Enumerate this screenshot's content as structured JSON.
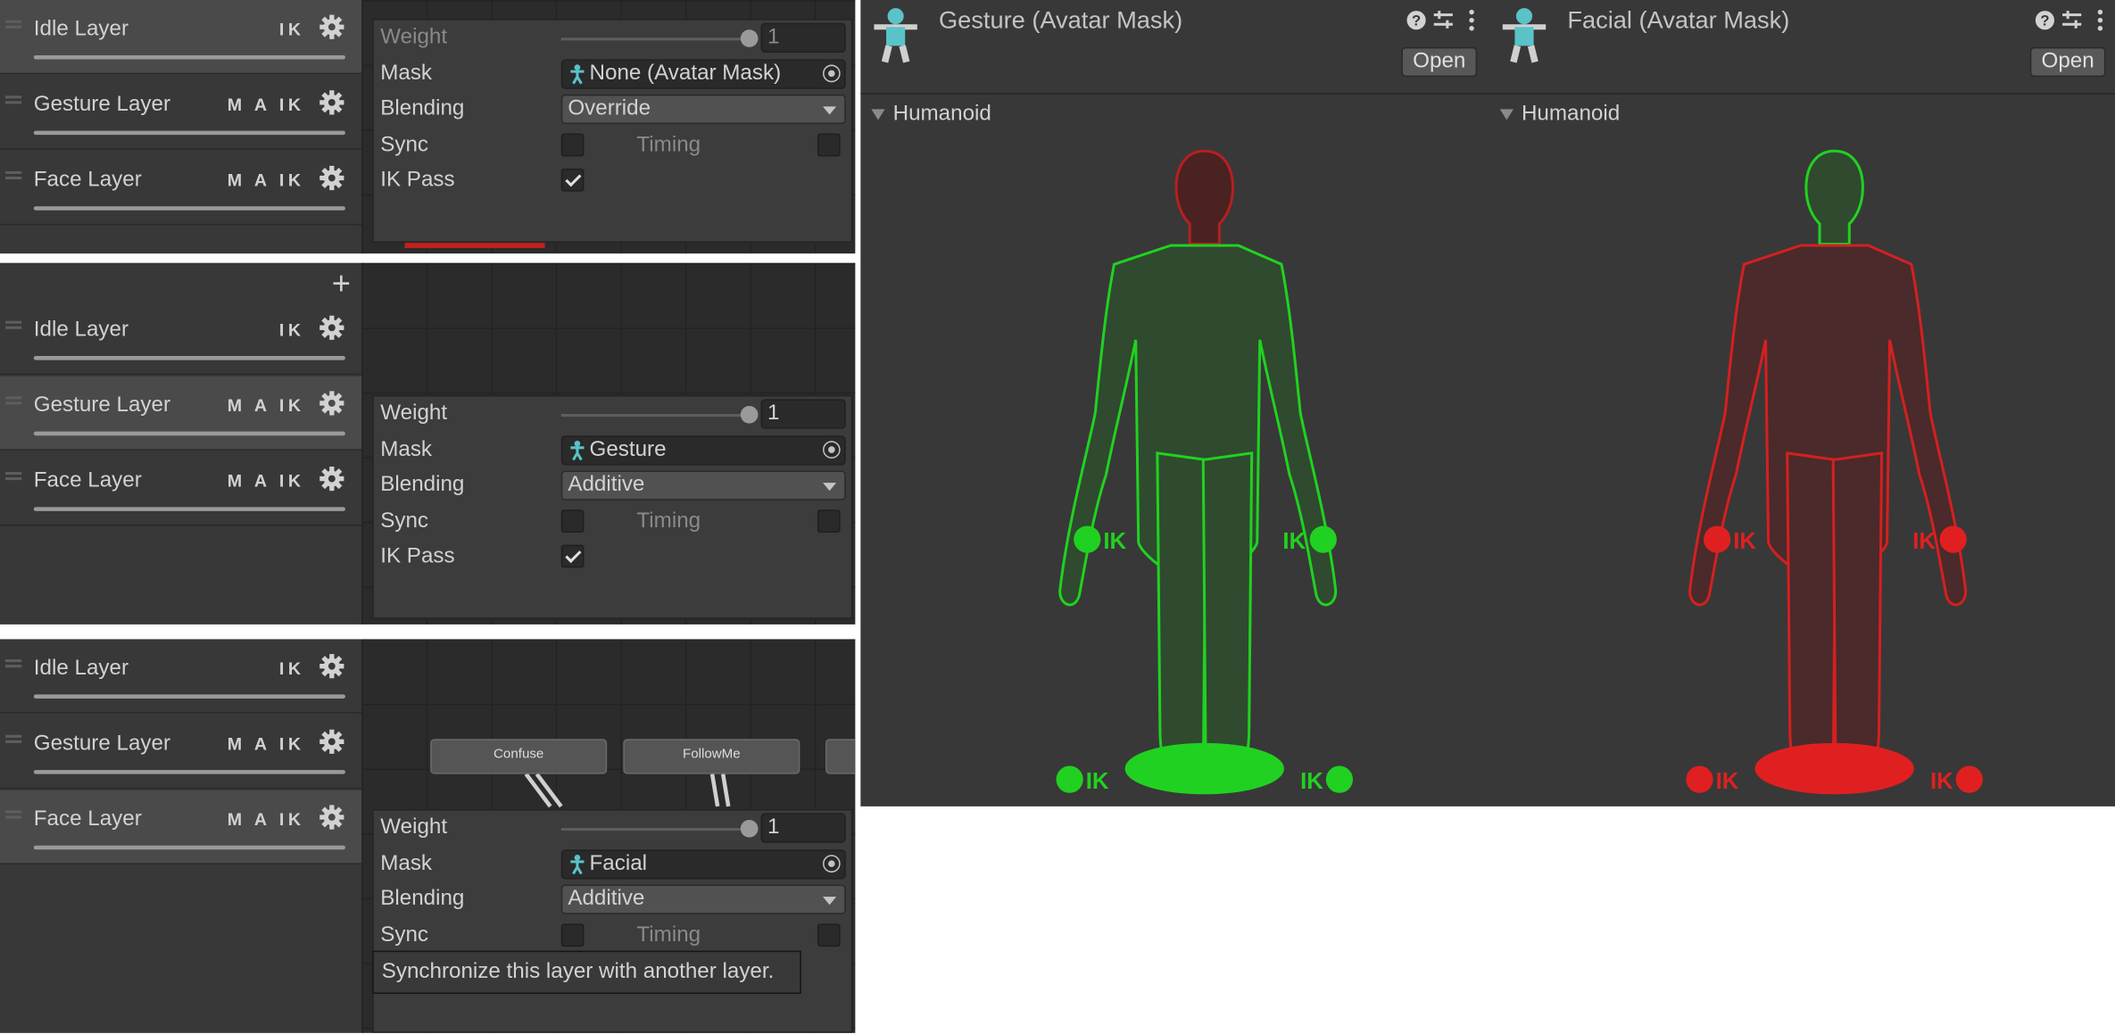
{
  "layers": [
    {
      "name": "Idle Layer",
      "flags": "IK"
    },
    {
      "name": "Gesture Layer",
      "flags": "M A IK"
    },
    {
      "name": "Face Layer",
      "flags": "M A IK"
    }
  ],
  "inspector": {
    "labels": {
      "weight": "Weight",
      "mask": "Mask",
      "blending": "Blending",
      "sync": "Sync",
      "timing": "Timing",
      "ik_pass": "IK Pass"
    },
    "panel1": {
      "weight": "1",
      "mask": "None (Avatar Mask)",
      "blending": "Override",
      "sync": false,
      "ik_pass": true
    },
    "panel2": {
      "weight": "1",
      "mask": "Gesture",
      "blending": "Additive",
      "sync": false,
      "ik_pass": true
    },
    "panel3": {
      "weight": "1",
      "mask": "Facial",
      "blending": "Additive",
      "sync": false
    }
  },
  "tooltip": "Synchronize this layer with another layer.",
  "nodes": [
    "Confuse",
    "FollowMe"
  ],
  "masks": [
    {
      "title": "Gesture (Avatar Mask)",
      "open": "Open",
      "section": "Humanoid",
      "head_color": "#b52020",
      "body_color": "#21d121",
      "ik": "IK"
    },
    {
      "title": "Facial (Avatar Mask)",
      "open": "Open",
      "section": "Humanoid",
      "head_color": "#21d121",
      "body_color": "#d42020",
      "ik": "IK"
    }
  ],
  "colors": {
    "green": "#21d121",
    "red": "#e02020",
    "accent": "#59c3c8"
  }
}
